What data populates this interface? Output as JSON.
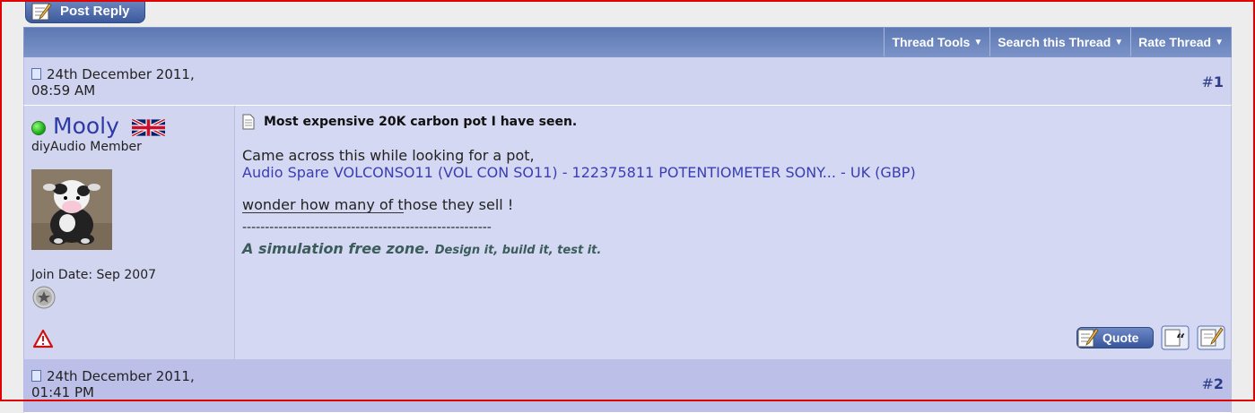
{
  "buttons": {
    "post_reply": "Post Reply",
    "quote": "Quote"
  },
  "toolbar": {
    "thread_tools": "Thread Tools",
    "search_thread": "Search this Thread",
    "rate_thread": "Rate Thread"
  },
  "post1": {
    "date_line1": "24th December 2011,",
    "date_line2": "08:59 AM",
    "number_hash": "#",
    "number": "1",
    "username": "Mooly",
    "user_title": "diyAudio Member",
    "join_date": "Join Date: Sep 2007",
    "title": "Most expensive 20K carbon pot I have seen.",
    "message_line1": "Came across this while looking for a pot,",
    "message_link": "Audio Spare VOLCONSO11 (VOL CON SO11) - 122375811 POTENTIOMETER SONY... - UK (GBP)",
    "message_line3": "wonder how many of those they sell !",
    "sig_dashes": "-------------------------------------------------------",
    "sig_big": "A simulation free zone.",
    "sig_small": "Design it, build it, test it."
  },
  "post2": {
    "date_line1": "24th December 2011,",
    "date_line2": "01:41 PM",
    "number_hash": "#",
    "number": "2"
  },
  "icons": [
    "post-reply-icon",
    "caret-down-icon",
    "post-doc-icon",
    "online-status-icon",
    "uk-flag-icon",
    "avatar",
    "reputation-star-icon",
    "report-post-icon",
    "quote-icon",
    "multi-quote-icon",
    "quick-reply-icon"
  ]
}
